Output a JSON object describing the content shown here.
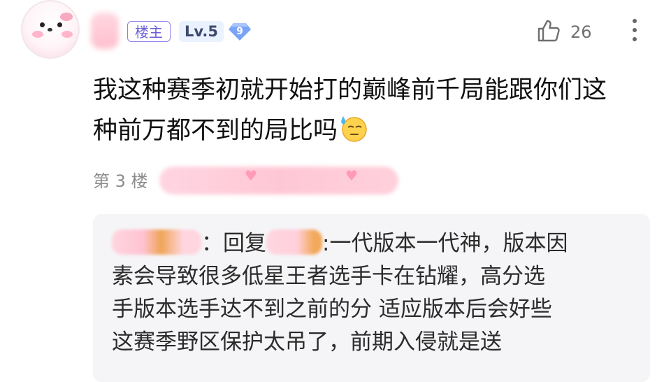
{
  "post": {
    "author_badge": "楼主",
    "level": "Lv.5",
    "level_gem": "9",
    "likes": "26",
    "content_line1": "我这种赛季初就开始打的巅峰前千局能跟你们这",
    "content_line2": "种前万都不到的局比吗",
    "floor": "第 3 楼"
  },
  "reply": {
    "separator": "：",
    "reply_word": "回复",
    "line1_text": ":一代版本一代神，版本因",
    "line2": "素会导致很多低星王者选手卡在钻耀，高分选",
    "line3": "手版本选手达不到之前的分 适应版本后会好些",
    "line4": "这赛季野区保护太吊了，前期入侵就是送"
  },
  "colors": {
    "badge_border": "#8b80e8",
    "level_bg": "#eaf2ff",
    "gem": "#6f9cf5",
    "reply_bg": "#f5f5f7"
  },
  "icons": [
    "avatar",
    "diamond-level-icon",
    "thumbs-up-icon",
    "more-vertical-icon",
    "sweat-emoji-icon"
  ]
}
